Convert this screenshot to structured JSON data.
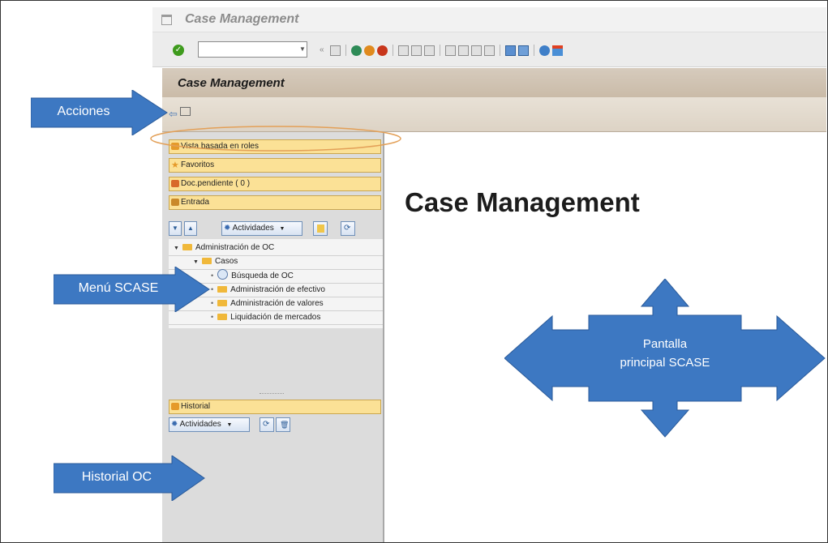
{
  "window": {
    "title": "Case Management"
  },
  "app": {
    "title": "Case Management"
  },
  "nav": {
    "vista": "Vista basada en roles",
    "favoritos": "Favoritos",
    "pendiente": "Doc.pendiente ( 0 )",
    "entrada": "Entrada",
    "historial": "Historial"
  },
  "actions": {
    "actividades_1": "Actividades",
    "actividades_2": "Actividades"
  },
  "tree": {
    "root": "Administración de OC",
    "casos": "Casos",
    "busqueda": "Búsqueda de OC",
    "efectivo": "Administración de efectivo",
    "valores": "Administración de valores",
    "liquidacion": "Liquidación de mercados"
  },
  "main": {
    "heading": "Case Management"
  },
  "callouts": {
    "acciones": "Acciones",
    "menu": "Menú SCASE",
    "historial": "Historial OC",
    "pantalla_line1": "Pantalla",
    "pantalla_line2": "principal SCASE"
  },
  "colors": {
    "callout_blue": "#3d78c2",
    "nav_yellow": "#fbe196",
    "title_beige": "#cabba8"
  }
}
